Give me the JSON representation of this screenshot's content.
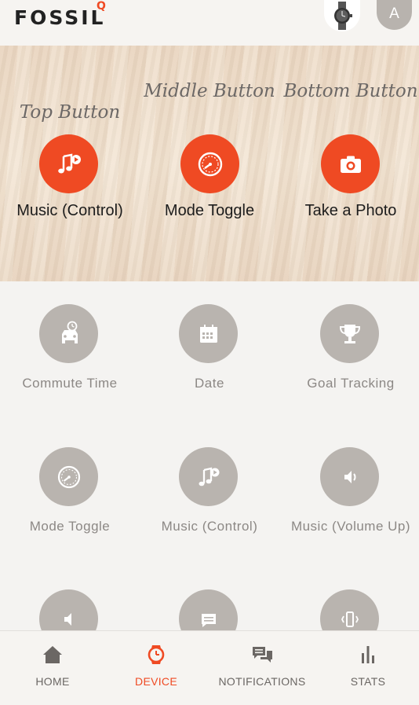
{
  "header": {
    "brand": "FOSSIL",
    "brand_superscript": "Q",
    "user_initial": "A",
    "accent_color": "#ef4a23"
  },
  "buttons": [
    {
      "title": "Top Button",
      "icon": "music-icon",
      "label": "Music (Control)"
    },
    {
      "title": "Middle Button",
      "icon": "gauge-icon",
      "label": "Mode Toggle"
    },
    {
      "title": "Bottom Button",
      "icon": "camera-icon",
      "label": "Take a Photo"
    }
  ],
  "actions": [
    {
      "label": "Commute Time",
      "icon": "commute-car-icon"
    },
    {
      "label": "Date",
      "icon": "calendar-icon"
    },
    {
      "label": "Goal Tracking",
      "icon": "trophy-icon"
    },
    {
      "label": "Mode Toggle",
      "icon": "gauge-icon"
    },
    {
      "label": "Music (Control)",
      "icon": "music-icon"
    },
    {
      "label": "Music (Volume Up)",
      "icon": "volume-up-icon"
    },
    {
      "label": "",
      "icon": "volume-down-icon"
    },
    {
      "label": "",
      "icon": "message-icon"
    },
    {
      "label": "",
      "icon": "vibrate-icon"
    }
  ],
  "nav": {
    "home": "HOME",
    "device": "DEVICE",
    "notifications": "NOTIFICATIONS",
    "stats": "STATS"
  }
}
